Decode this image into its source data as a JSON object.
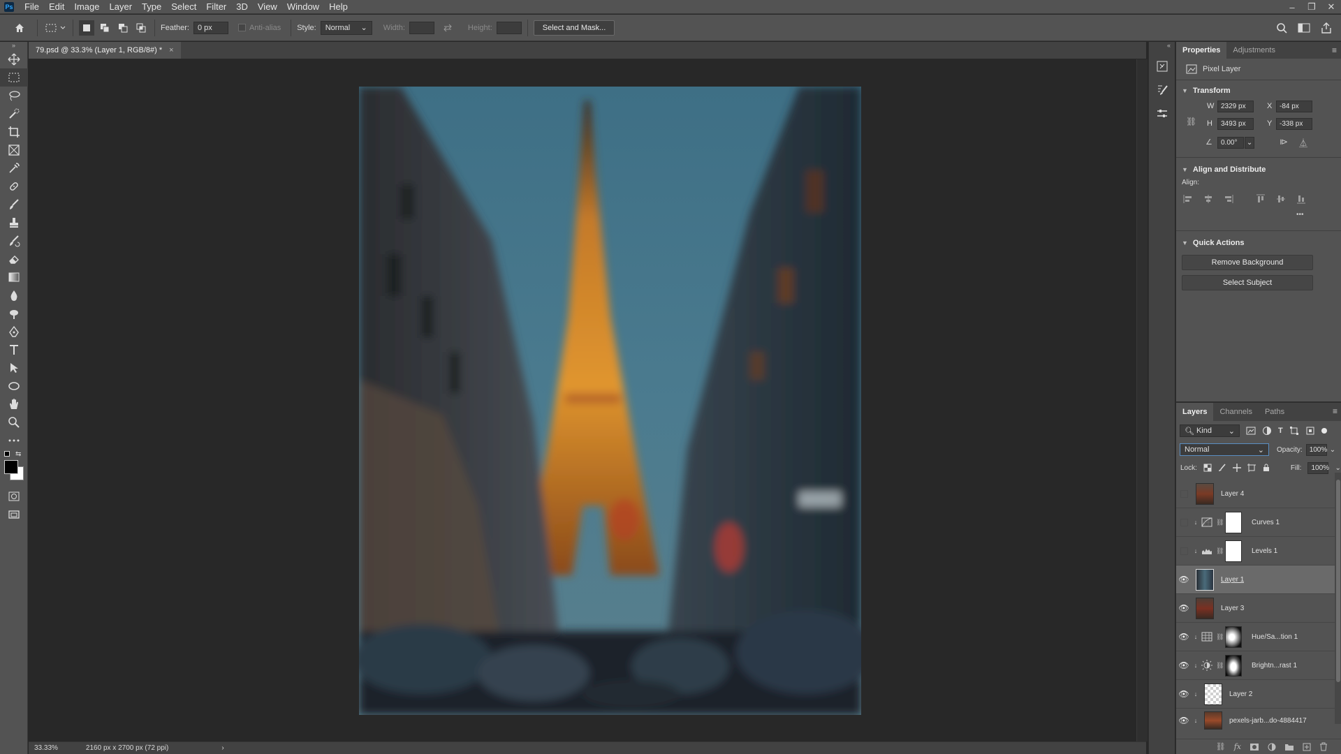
{
  "menu": {
    "logo": "Ps",
    "items": [
      "File",
      "Edit",
      "Image",
      "Layer",
      "Type",
      "Select",
      "Filter",
      "3D",
      "View",
      "Window",
      "Help"
    ]
  },
  "window_controls": {
    "minimize": "–",
    "restore": "❐",
    "close": "✕"
  },
  "options": {
    "feather_label": "Feather:",
    "feather_value": "0 px",
    "antialias_label": "Anti-alias",
    "style_label": "Style:",
    "style_value": "Normal",
    "width_label": "Width:",
    "height_label": "Height:",
    "select_and_mask": "Select and Mask..."
  },
  "document": {
    "tab_title": "79.psd @ 33.3% (Layer 1, RGB/8#) *",
    "close": "×"
  },
  "status": {
    "zoom": "33.33%",
    "doc_info": "2160 px x 2700 px (72 ppi)",
    "arrow": "›"
  },
  "properties": {
    "tabs": [
      "Properties",
      "Adjustments"
    ],
    "layer_type": "Pixel Layer",
    "transform": {
      "title": "Transform",
      "w_label": "W",
      "w_value": "2329 px",
      "h_label": "H",
      "h_value": "3493 px",
      "x_label": "X",
      "x_value": "-84 px",
      "y_label": "Y",
      "y_value": "-338 px",
      "angle_value": "0.00°"
    },
    "align": {
      "title": "Align and Distribute",
      "align_label": "Align:",
      "more": "•••"
    },
    "quick_actions": {
      "title": "Quick Actions",
      "remove_background": "Remove Background",
      "select_subject": "Select Subject"
    }
  },
  "layers": {
    "tabs": [
      "Layers",
      "Channels",
      "Paths"
    ],
    "kind_label": "Kind",
    "blend_mode": "Normal",
    "opacity_label": "Opacity:",
    "opacity_value": "100%",
    "lock_label": "Lock:",
    "fill_label": "Fill:",
    "fill_value": "100%",
    "items": [
      {
        "name": "Layer 4",
        "visible": false,
        "type": "pixel"
      },
      {
        "name": "Curves 1",
        "visible": false,
        "type": "curves"
      },
      {
        "name": "Levels 1",
        "visible": false,
        "type": "levels"
      },
      {
        "name": "Layer 1",
        "visible": true,
        "type": "pixel",
        "selected": true
      },
      {
        "name": "Layer 3",
        "visible": true,
        "type": "pixel"
      },
      {
        "name": "Hue/Sa...tion 1",
        "visible": true,
        "type": "hue"
      },
      {
        "name": "Brightn...rast 1",
        "visible": true,
        "type": "brightness"
      },
      {
        "name": "Layer 2",
        "visible": true,
        "type": "transparent"
      },
      {
        "name": "pexels-jarb...do-4884417",
        "visible": true,
        "type": "pixel"
      }
    ],
    "footer_icons": [
      "link-icon",
      "fx-icon",
      "mask-icon",
      "adjustment-icon",
      "folder-icon",
      "new-layer-icon",
      "trash-icon"
    ]
  },
  "colors": {
    "ui_dark": "#282828",
    "ui_panel": "#535353",
    "ui_tab_bg": "#424242",
    "accent_blue": "#31a8ff",
    "selected_row": "#6a6a6a"
  }
}
